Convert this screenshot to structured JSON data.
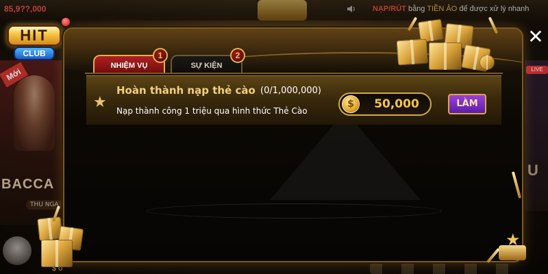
{
  "background": {
    "balance": "85,9??,000",
    "ticker": {
      "part1": "NẠP/RÚT",
      "part2": " bằng ",
      "part3": "TIỀN ẢO",
      "part4": " để được xử lý nhanh"
    },
    "left_badge": "Mới",
    "left_game": "BACCA",
    "left_pill": "THU NGA",
    "live_badge": "LIVE",
    "right_text": "U",
    "bottom_amount": "$ 0"
  },
  "logo": {
    "hit": "HIT",
    "club": "CLUB"
  },
  "tabs": [
    {
      "label": "NHIỆM VỤ",
      "badge": "1",
      "active": true
    },
    {
      "label": "SỰ KIỆN",
      "badge": "2",
      "active": false
    }
  ],
  "quest": {
    "icon": "star-icon",
    "title": "Hoàn thành nạp thẻ cào",
    "progress": "(0/1,000,000)",
    "description": "Nạp thành công 1 triệu qua hình thức Thẻ Cào",
    "reward": {
      "coin_icon": "coin-icon",
      "coin_symbol": "$",
      "value": "50,000"
    },
    "action_label": "LÀM"
  },
  "close_symbol": "✕",
  "colors": {
    "accent_gold": "#d9a941",
    "tab_active": "#b02020",
    "button_purple": "#7a2ed0",
    "reward_text": "#f7c548"
  }
}
